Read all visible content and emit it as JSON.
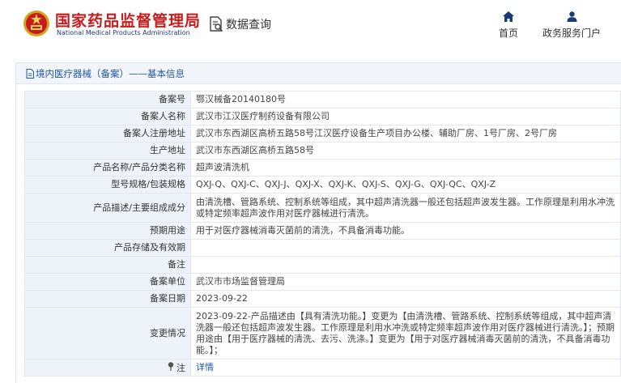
{
  "header": {
    "site_title": "国家药品监督管理局",
    "site_subtitle": "National Medical Products Administration",
    "data_query_label": "数据查询",
    "nav": {
      "home_label": "首页",
      "services_label": "政务服务门户"
    }
  },
  "breadcrumb": {
    "text": "境内医疗器械（备案）——基本信息"
  },
  "rows": [
    {
      "label": "备案号",
      "value": "鄂汉械备20140180号"
    },
    {
      "label": "备案人名称",
      "value": "武汉市江汉医疗制药设备有限公司"
    },
    {
      "label": "备案人注册地址",
      "value": "武汉市东西湖区高桥五路58号江汉医疗设备生产项目办公楼、辅助厂房、1号厂房、2号厂房"
    },
    {
      "label": "生产地址",
      "value": "武汉市东西湖区高桥五路58号"
    },
    {
      "label": "产品名称/产品分类名称",
      "value": "超声波清洗机"
    },
    {
      "label": "型号规格/包装规格",
      "value": "QXJ-Q、QXJ-C、QXJ-J、QXJ-X、QXJ-K、QXJ-S、QXJ-G、QXJ-QC、QXJ-Z"
    },
    {
      "label": "产品描述/主要组成成分",
      "value": "由清洗槽、管路系统、控制系统等组成，其中超声清洗器一般还包括超声波发生器。工作原理是利用水冲洗或特定频率超声波作用对医疗器械进行清洗。"
    },
    {
      "label": "预期用途",
      "value": "用于对医疗器械消毒灭菌前的清洗，不具备消毒功能。"
    },
    {
      "label": "产品存储及有效期",
      "value": ""
    },
    {
      "label": "备注",
      "value": ""
    },
    {
      "label": "备案单位",
      "value": "武汉市市场监督管理局"
    },
    {
      "label": "备案日期",
      "value": "2023-09-22"
    },
    {
      "label": "变更情况",
      "value": "2023-09-22-产品描述由【具有清洗功能。】变更为【由清洗槽、管路系统、控制系统等组成，其中超声清洗器一般还包括超声波发生器。工作原理是利用水冲洗或特定频率超声波作用对医疗器械进行清洗。】；预期用途由【用于医疗器械的清洗、去污、洗涤。】变更为【用于对医疗器械消毒灭菌前的清洗，不具备消毒功能。】；"
    },
    {
      "label": "注",
      "value": "详情"
    }
  ],
  "colors": {
    "brand_red": "#c51d1d",
    "link_blue": "#1e56a8",
    "label_bg": "#eef3f9",
    "header_navy": "#1b3a7a"
  },
  "icons": {
    "emblem": "national-emblem-icon",
    "data_query": "document-search-icon",
    "home": "home-icon",
    "services": "user-icon",
    "breadcrumb": "document-icon",
    "note": "pin-icon"
  }
}
